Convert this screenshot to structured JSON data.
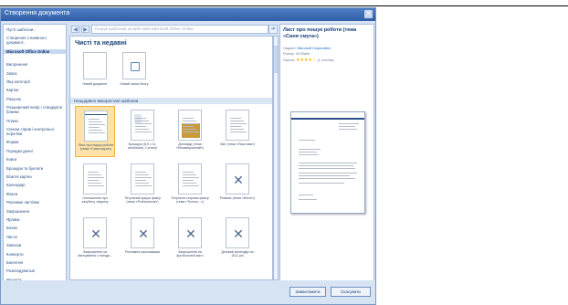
{
  "topbar": {
    "fragment": ""
  },
  "dialog": {
    "title": "Створення документа"
  },
  "sidebar": {
    "items": [
      "Пусті шаблони...",
      "Створення з наявного документ...",
      "Microsoft Office Online",
      "Вигорнення",
      "Запис",
      "Ящі категорії",
      "Картки",
      "Рахунок",
      "Розширений папір і стандартні бланки",
      "Плани",
      "Списки справ і контрольні переліки",
      "Форми",
      "Порядки денні",
      "Книги",
      "Брошури та буклети",
      "Візитні картки",
      "Календарі",
      "Факси",
      "Рекламні листівки",
      "Запрошення",
      "Ярлики",
      "Бланк",
      "Листи",
      "Записки",
      "Конверти",
      "Бюлетені",
      "Розкладувальні",
      "Рецепти",
      "Резюме",
      "Розклади"
    ]
  },
  "nav": {
    "search_placeholder": "Пошук шаблонів на веб-сайті Microsoft Office Online"
  },
  "content": {
    "title": "Чисті та недавні",
    "recent_tiles": [
      {
        "label": "Новий документ"
      },
      {
        "label": "Новий запис блогу"
      }
    ],
    "section_label": "Нещодавно використані шаблони",
    "templates": [
      {
        "label": "Лист про пошук роботи (тема «Синя смуга»)"
      },
      {
        "label": "Брошура (8,5 x 11, альбомна, 2 згини)"
      },
      {
        "label": "Доповідь (тема «Незавершений»)"
      },
      {
        "label": "Звіт (тема «Поштова»)"
      },
      {
        "label": "Оголошення про загубену тварину"
      },
      {
        "label": "Титульний аркуш факсу (тема «Professional»)"
      },
      {
        "label": "Титульна сторінка факсу (тема «Технол...»)"
      },
      {
        "label": "Резюме (тема «Місто»)"
      },
      {
        "label": "Запрошення на святкування з нагоди..."
      },
      {
        "label": "Рекламна прокламація"
      },
      {
        "label": "Запрошення на футбольний матч"
      },
      {
        "label": "Діловий календар на 2011 рік"
      }
    ]
  },
  "preview": {
    "title": "Лист про пошук роботи (тема «Синя смуга»)",
    "provider_label": "Надано:",
    "provider": "Microsoft Corporation",
    "size_label": "Розмір:",
    "size": "34 Кбайт",
    "rating_label": "Оцінка:",
    "votes": "(1 голосів)",
    "rating": 4
  },
  "buttons": {
    "download": "Завантажити",
    "cancel": "Скасувати"
  },
  "colors": {
    "accent": "#2f5ea6",
    "selection": "#fde3a7"
  }
}
